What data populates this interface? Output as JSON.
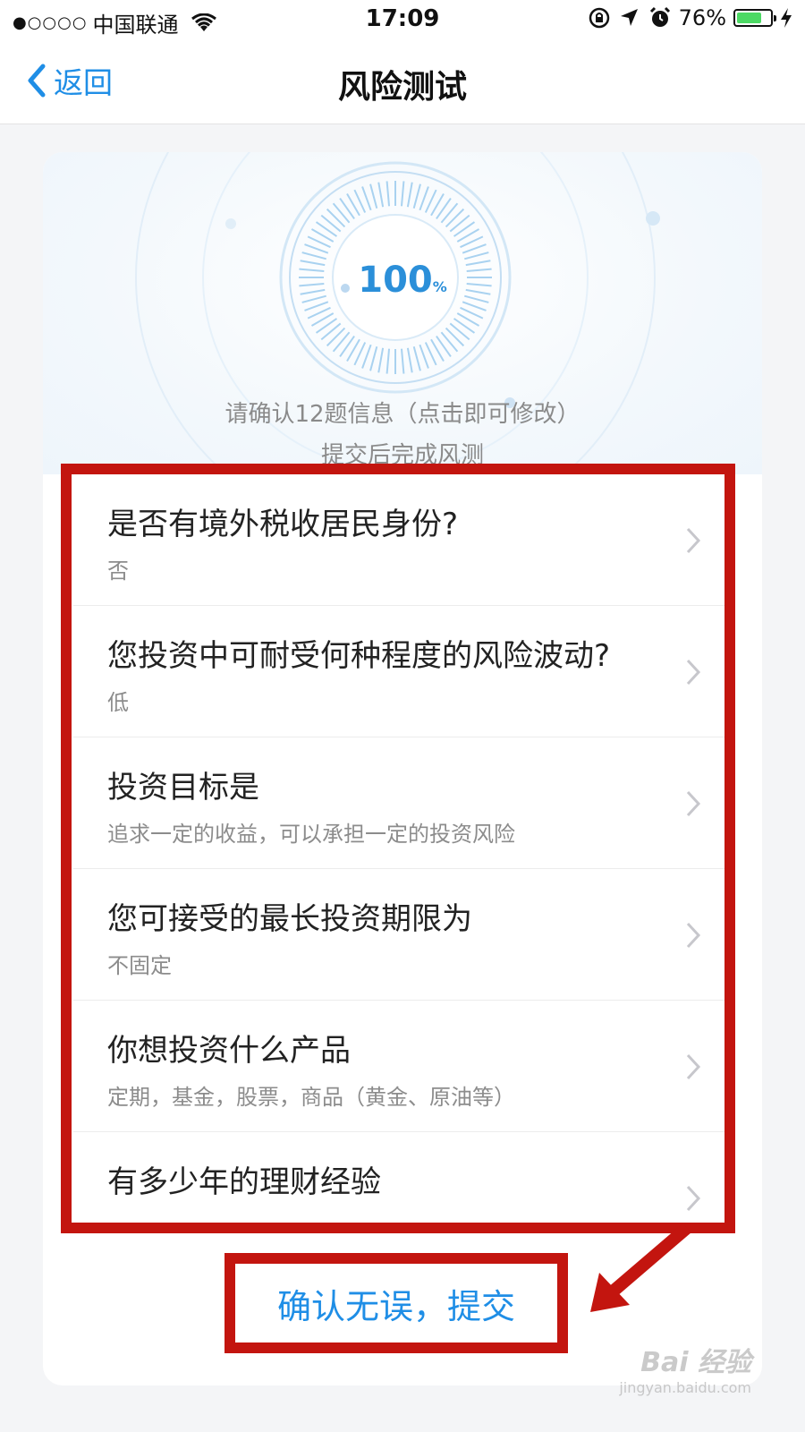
{
  "status_bar": {
    "signal_dots": "●○○○○",
    "carrier": "中国联通",
    "time": "17:09",
    "battery_percent": "76%",
    "battery_level": 0.76,
    "battery_color": "#4cd964"
  },
  "nav": {
    "back_label": "返回",
    "title": "风险测试"
  },
  "progress": {
    "value": "100",
    "unit": "%"
  },
  "confirm": {
    "line1": "请确认12题信息（点击即可修改）",
    "line2": "提交后完成风测"
  },
  "questions": [
    {
      "title": "是否有境外税收居民身份?",
      "answer": "否"
    },
    {
      "title": "您投资中可耐受何种程度的风险波动?",
      "answer": "低"
    },
    {
      "title": "投资目标是",
      "answer": "追求一定的收益，可以承担一定的投资风险"
    },
    {
      "title": "您可接受的最长投资期限为",
      "answer": "不固定"
    },
    {
      "title": "你想投资什么产品",
      "answer": "定期，基金，股票，商品（黄金、原油等）"
    },
    {
      "title": "有多少年的理财经验",
      "answer": ""
    }
  ],
  "submit_label": "确认无误，提交",
  "watermark": {
    "logo": "Bai 经验",
    "url": "jingyan.baidu.com"
  },
  "colors": {
    "accent": "#1f8ee6",
    "highlight": "#c3150f"
  },
  "icons": {
    "wifi": "wifi-icon",
    "lock_rotation": "lock-rotation-icon",
    "location": "location-arrow-icon",
    "alarm": "alarm-icon",
    "charging": "bolt-icon",
    "back": "back-chevron-icon",
    "row": "chevron-right-icon"
  }
}
